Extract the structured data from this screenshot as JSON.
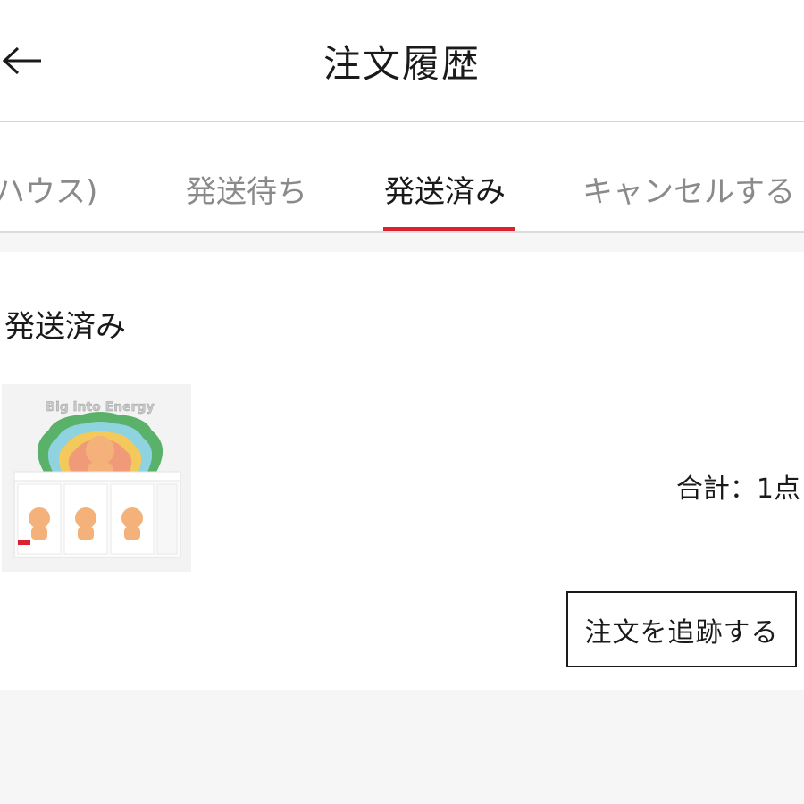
{
  "header": {
    "title": "注文履歴",
    "back_icon": "arrow-left-icon"
  },
  "tabs": [
    {
      "label": "ハウス)",
      "active": false
    },
    {
      "label": "発送待ち",
      "active": false
    },
    {
      "label": "発送済み",
      "active": true
    },
    {
      "label": "キャンセルする",
      "active": false
    }
  ],
  "order": {
    "status": "発送済み",
    "product_image_text": "Big into Energy",
    "total": "合計：1点",
    "track_button": "注文を追跡する"
  },
  "colors": {
    "accent": "#d8222f",
    "background": "#f6f6f6",
    "card": "#ffffff"
  }
}
